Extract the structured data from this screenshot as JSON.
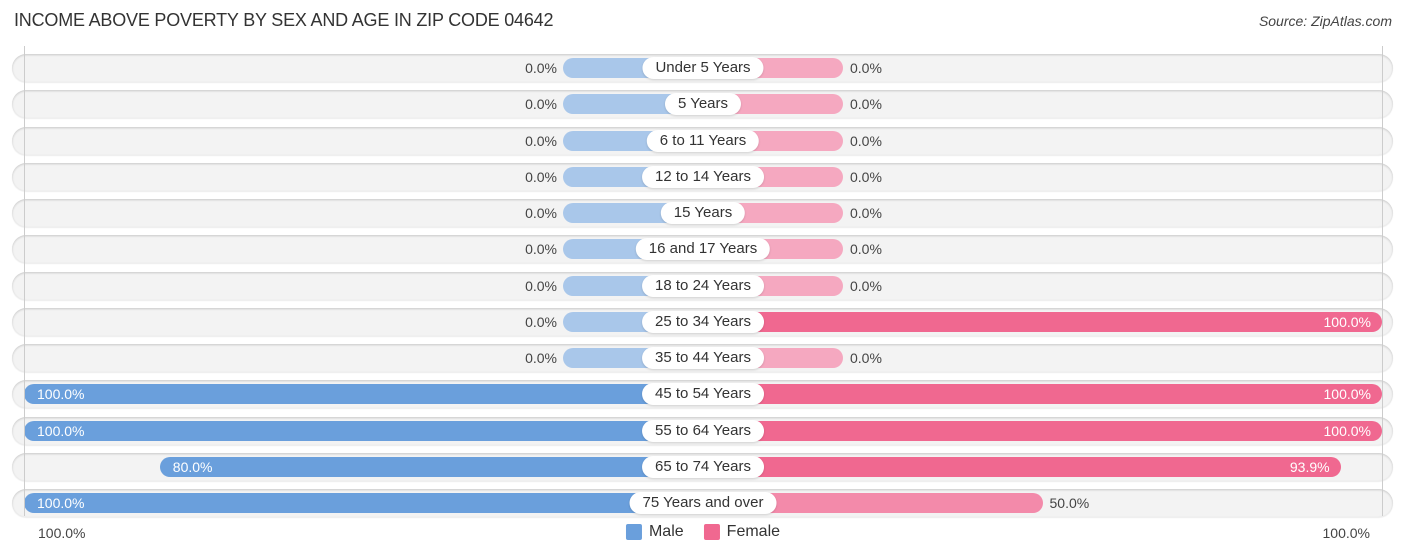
{
  "header": {
    "title": "INCOME ABOVE POVERTY BY SEX AND AGE IN ZIP CODE 04642",
    "source": "Source: ZipAtlas.com"
  },
  "colors": {
    "male": "#6a9fdc",
    "female": "#f06890",
    "male_light": "#a9c7ea",
    "female_light": "#f5a8c0",
    "row_bg": "#f3f3f3"
  },
  "axis": {
    "left_label": "100.0%",
    "right_label": "100.0%"
  },
  "legend": {
    "male_label": "Male",
    "female_label": "Female"
  },
  "chart_data": {
    "type": "bar",
    "title": "INCOME ABOVE POVERTY BY SEX AND AGE IN ZIP CODE 04642",
    "orientation": "horizontal-diverging",
    "xlim": [
      -100,
      100
    ],
    "legend_position": "bottom-center",
    "categories": [
      "Under 5 Years",
      "5 Years",
      "6 to 11 Years",
      "12 to 14 Years",
      "15 Years",
      "16 and 17 Years",
      "18 to 24 Years",
      "25 to 34 Years",
      "35 to 44 Years",
      "45 to 54 Years",
      "55 to 64 Years",
      "65 to 74 Years",
      "75 Years and over"
    ],
    "series": [
      {
        "name": "Male",
        "values": [
          0.0,
          0.0,
          0.0,
          0.0,
          0.0,
          0.0,
          0.0,
          0.0,
          0.0,
          100.0,
          100.0,
          80.0,
          100.0
        ],
        "labels": [
          "0.0%",
          "0.0%",
          "0.0%",
          "0.0%",
          "0.0%",
          "0.0%",
          "0.0%",
          "0.0%",
          "0.0%",
          "100.0%",
          "100.0%",
          "80.0%",
          "100.0%"
        ]
      },
      {
        "name": "Female",
        "values": [
          0.0,
          0.0,
          0.0,
          0.0,
          0.0,
          0.0,
          0.0,
          100.0,
          0.0,
          100.0,
          100.0,
          93.9,
          50.0
        ],
        "labels": [
          "0.0%",
          "0.0%",
          "0.0%",
          "0.0%",
          "0.0%",
          "0.0%",
          "0.0%",
          "100.0%",
          "0.0%",
          "100.0%",
          "100.0%",
          "93.9%",
          "50.0%"
        ]
      }
    ],
    "xlabel": "",
    "ylabel": ""
  }
}
